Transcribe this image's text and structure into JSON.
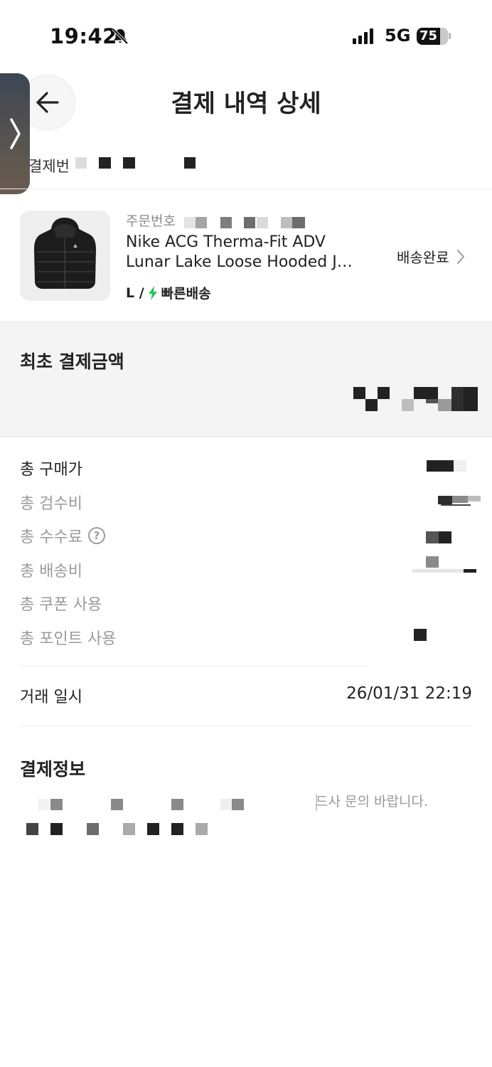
{
  "status_bar": {
    "time": "19:42",
    "network": "5G",
    "battery": "75"
  },
  "header": {
    "title": "결제 내역 상세"
  },
  "payment_number": {
    "label": "결제번"
  },
  "order": {
    "number_label": "주문번호",
    "product_line1": "Nike ACG Therma-Fit ADV",
    "product_line2": "Lunar Lake Loose Hooded Ja...",
    "size": "L /",
    "shipping_type": "빠른배송",
    "status": "배송완료",
    "icons": {
      "shipping": "lightning-icon",
      "status": "chevron-right-icon"
    },
    "colors": {
      "shipping_icon": "#22c55e"
    }
  },
  "summary": {
    "title": "최초 결제금액",
    "rows": [
      {
        "label": "총 구매가"
      },
      {
        "label": "총 검수비"
      },
      {
        "label": "총 수수료",
        "icon": "question-icon",
        "icon_glyph": "?"
      },
      {
        "label": "총 배송비"
      },
      {
        "label": "총 쿠폰 사용"
      },
      {
        "label": "총 포인트 사용"
      }
    ]
  },
  "transaction": {
    "label": "거래 일시",
    "value": "26/01/31 22:19"
  },
  "payment_info": {
    "title": "결제정보",
    "note": "드사 문의 바랍니다."
  }
}
